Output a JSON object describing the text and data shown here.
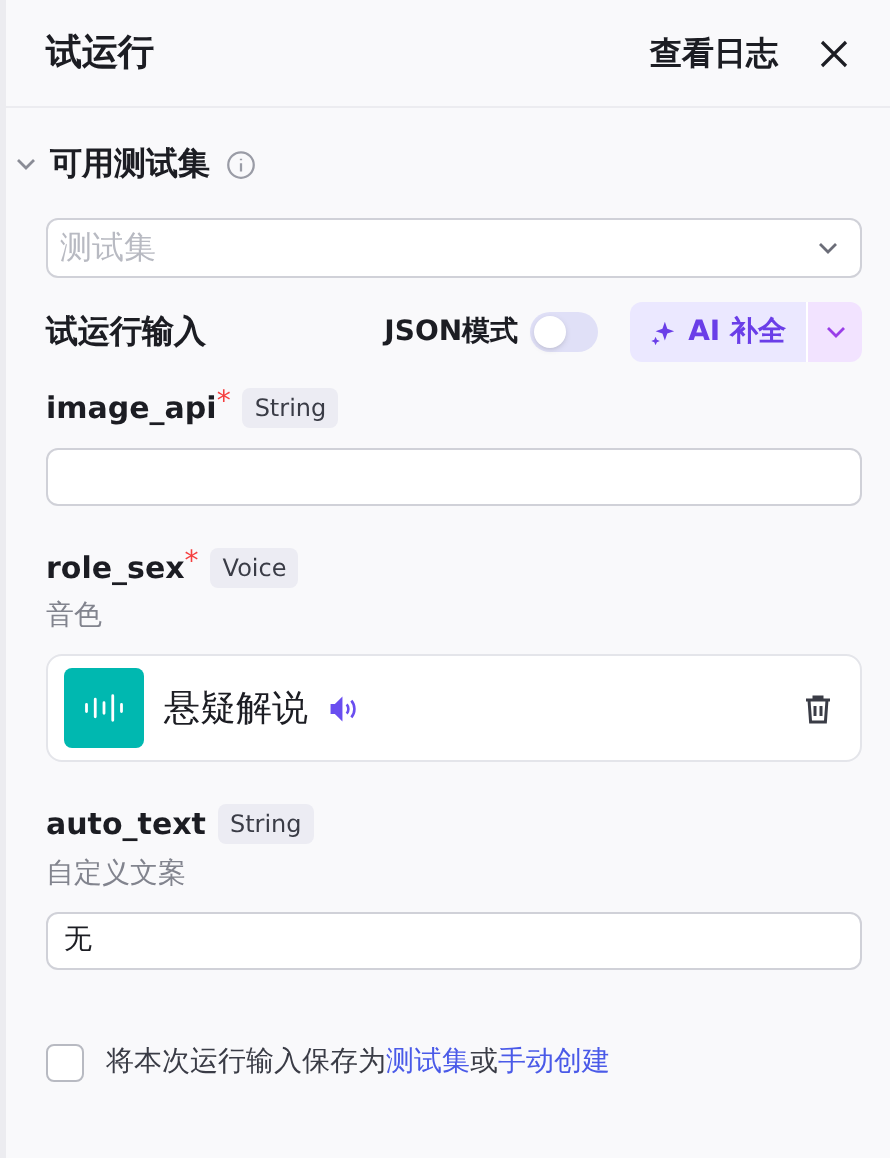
{
  "header": {
    "title": "试运行",
    "log_link": "查看日志"
  },
  "test_set_section": {
    "title": "可用测试集",
    "expanded": true,
    "select": {
      "placeholder": "测试集"
    }
  },
  "run_input": {
    "title": "试运行输入",
    "json_mode": {
      "label": "JSON模式",
      "on": false
    },
    "ai_button": "AI 补全"
  },
  "fields": [
    {
      "kind": "text",
      "name": "image_api",
      "required_mark": "*",
      "type": "String"
    },
    {
      "kind": "voice",
      "name": "role_sex",
      "required_mark": "*",
      "type": "Voice",
      "description": "音色",
      "voice_name": "悬疑解说"
    },
    {
      "kind": "text",
      "name": "auto_text",
      "type": "String",
      "description": "自定义文案",
      "value": "无"
    }
  ],
  "save_option": {
    "checked": false,
    "segments": [
      {
        "kind": "text",
        "text": "将本次运行输入保存为"
      },
      {
        "kind": "link",
        "text": "测试集"
      },
      {
        "kind": "text",
        "text": "或"
      },
      {
        "kind": "link",
        "text": "手动创建"
      }
    ]
  }
}
